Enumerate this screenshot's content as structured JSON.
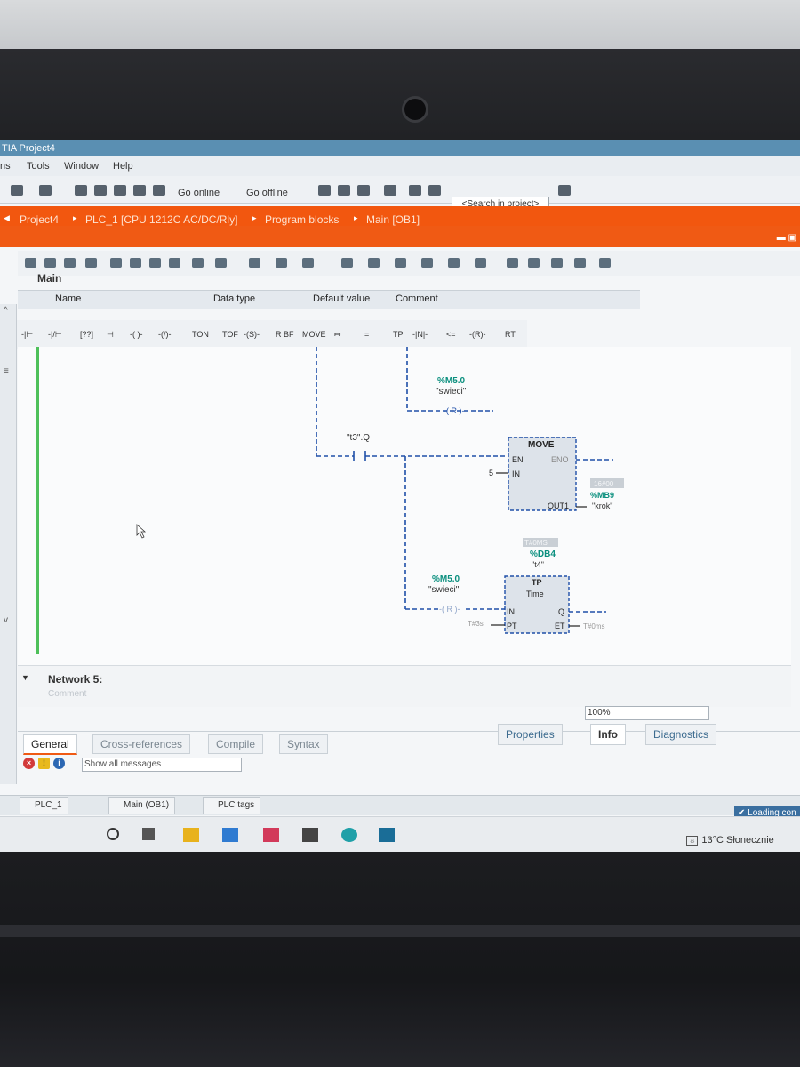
{
  "app": {
    "title": "TIA Project4"
  },
  "menu": {
    "items": [
      "ns",
      "Tools",
      "Window",
      "Help"
    ]
  },
  "toolbar": {
    "go_online": "Go online",
    "go_offline": "Go offline",
    "search_placeholder": "<Search in project>"
  },
  "breadcrumb": [
    "Project4",
    "PLC_1 [CPU 1212C AC/DC/Rly]",
    "Program blocks",
    "Main [OB1]"
  ],
  "block": {
    "title": "Main",
    "interface_columns": [
      "Name",
      "Data type",
      "Default value",
      "Comment"
    ]
  },
  "ladder_palette": [
    "-|⊢",
    "-|/⊢",
    "[??]",
    "⊣",
    "-( )-",
    "-(/)-",
    "TON",
    "TOF",
    "-(S)-",
    "R BF",
    "MOVE",
    "↦",
    "=",
    "TP",
    "-|N|-",
    "<=",
    "-(R)-",
    "RT"
  ],
  "network": {
    "top_coil": {
      "address": "%M5.0",
      "tag": "\"swieci\"",
      "instr": "R"
    },
    "contact": {
      "tag": "\"t3\".Q"
    },
    "move_box": {
      "title": "MOVE",
      "en": "EN",
      "eno": "ENO",
      "in": "IN",
      "out": "OUT1",
      "in_value": "5",
      "out_hex": "16#00",
      "out_address": "%MB9",
      "out_tag": "\"krok\""
    },
    "timer_box": {
      "instance_value": "T#0MS",
      "instance_db": "%DB4",
      "instance_tag": "\"t4\"",
      "title": "TP",
      "subtitle": "Time",
      "in": "IN",
      "pt": "PT",
      "q": "Q",
      "et": "ET",
      "pt_value": "T#3s",
      "et_value": "T#0ms"
    },
    "bottom_coil": {
      "address": "%M5.0",
      "tag": "\"swieci\"",
      "instr": "R"
    }
  },
  "network5": {
    "title": "Network 5:",
    "comment_placeholder": "Comment"
  },
  "zoom": {
    "value": "100%"
  },
  "inspector": {
    "tabs": [
      "Properties",
      "Info",
      "Diagnostics"
    ],
    "active": "Info"
  },
  "lower": {
    "tabs": [
      "General",
      "Cross-references",
      "Compile",
      "Syntax"
    ],
    "active": "General",
    "filter": "Show all messages"
  },
  "portal": {
    "tabs": [
      "PLC_1",
      "Main (OB1)",
      "PLC tags"
    ],
    "loading": "Loading con"
  },
  "taskbar": {
    "temperature": "13°C",
    "weather": "Słonecznie"
  },
  "colors": {
    "accent": "#f05a14",
    "wire": "#1f4fa8",
    "address": "#0a8f7e",
    "active_rail": "#4ec05a"
  }
}
